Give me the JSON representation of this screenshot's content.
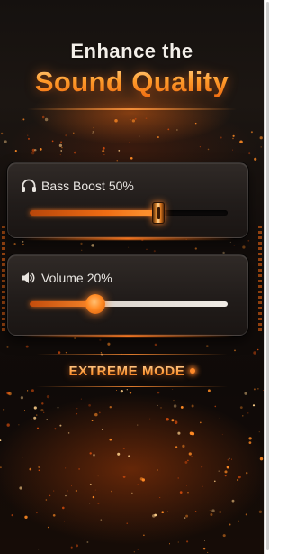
{
  "header": {
    "title_line1": "Enhance the",
    "title_line2": "Sound Quality"
  },
  "bass_boost": {
    "icon": "headphones-icon",
    "label": "Bass Boost",
    "value_text": "50%",
    "level": 0.65
  },
  "volume": {
    "icon": "speaker-icon",
    "label": "Volume",
    "value_text": "20%",
    "level": 0.33
  },
  "mode": {
    "label": "EXTREME MODE"
  },
  "colors": {
    "accent": "#ff8a24",
    "background": "#120d0b",
    "panel": "#262120"
  }
}
